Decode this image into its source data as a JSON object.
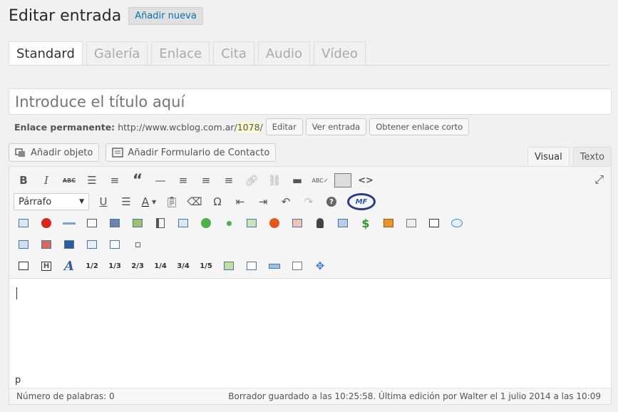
{
  "header": {
    "title": "Editar entrada",
    "add_new": "Añadir nueva"
  },
  "format_tabs": [
    "Standard",
    "Galería",
    "Enlace",
    "Cita",
    "Audio",
    "Vídeo"
  ],
  "title_placeholder": "Introduce el título aquí",
  "permalink": {
    "label": "Enlace permanente:",
    "url_base": "http://www.wcblog.com.ar/",
    "url_slug": "1078",
    "url_tail": "/",
    "buttons": [
      "Editar",
      "Ver entrada",
      "Obtener enlace corto"
    ]
  },
  "media_buttons": {
    "add_media": "Añadir objeto",
    "add_form": "Añadir Formulario de Contacto"
  },
  "editor_tabs": {
    "visual": "Visual",
    "text": "Texto"
  },
  "toolbar": {
    "format_select": "Párrafo",
    "mf_label": "MF",
    "fractions": [
      "1/2",
      "1/3",
      "2/3",
      "1/4",
      "3/4",
      "1/5"
    ]
  },
  "path_bar": "p",
  "status": {
    "word_count": "Número de palabras: 0",
    "autosave": "Borrador guardado a las 10:25:58. Última edición por Walter el 1 julio 2014 a las 10:09"
  }
}
